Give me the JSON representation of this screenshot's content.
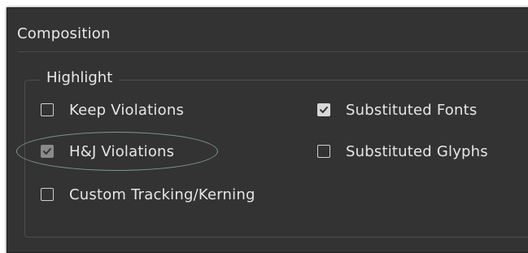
{
  "panel": {
    "title": "Composition"
  },
  "highlight": {
    "group_label": "Highlight",
    "options": [
      {
        "label": "Keep Violations",
        "checked": false,
        "disabled": false
      },
      {
        "label": "H&J Violations",
        "checked": true,
        "disabled": true
      },
      {
        "label": "Custom Tracking/Kerning",
        "checked": false,
        "disabled": false
      },
      {
        "label": "Substituted Fonts",
        "checked": true,
        "disabled": false
      },
      {
        "label": "Substituted Glyphs",
        "checked": false,
        "disabled": false
      }
    ]
  },
  "colors": {
    "panel_bg": "#333333",
    "text": "#e6e6e6",
    "annotation_ellipse": "#7e9a8e"
  },
  "annotation": {
    "icon": "ellipse-callout",
    "target": "H&J Violations"
  }
}
